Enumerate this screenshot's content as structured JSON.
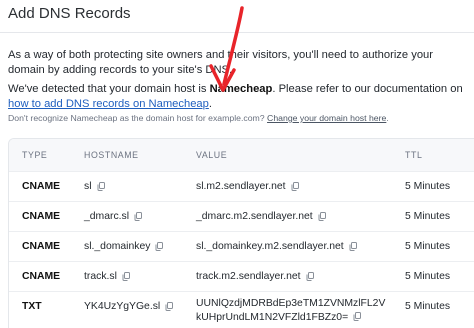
{
  "page": {
    "title": "Add DNS Records",
    "intro": "As a way of both protecting site owners and their visitors, you'll need to authorize your domain by adding records to your site's DNS.",
    "detect_prefix": "We've detected that your domain host is ",
    "detect_host": "Namecheap",
    "detect_middle": ". Please refer to our documentation on ",
    "detect_link": "how to add DNS records on Namecheap",
    "detect_suffix": ".",
    "hint_text": "Don't recognize Namecheap as the domain host for example.com? ",
    "hint_link": "Change your domain host here",
    "hint_suffix": "."
  },
  "table": {
    "headers": {
      "type": "TYPE",
      "hostname": "HOSTNAME",
      "value": "VALUE",
      "ttl": "TTL"
    },
    "rows": [
      {
        "type": "CNAME",
        "hostname": "sl",
        "value": "sl.m2.sendlayer.net",
        "ttl": "5 Minutes"
      },
      {
        "type": "CNAME",
        "hostname": "_dmarc.sl",
        "value": "_dmarc.m2.sendlayer.net",
        "ttl": "5 Minutes"
      },
      {
        "type": "CNAME",
        "hostname": "sl._domainkey",
        "value": "sl._domainkey.m2.sendlayer.net",
        "ttl": "5 Minutes"
      },
      {
        "type": "CNAME",
        "hostname": "track.sl",
        "value": "track.m2.sendlayer.net",
        "ttl": "5 Minutes"
      },
      {
        "type": "TXT",
        "hostname": "YK4UzYgYGe.sl",
        "value_line1": "UUNlQzdjMDRBdEp3eTM1ZVNMzlFL2V",
        "value_line2": "kUHprUndLM1N2VFZld1FBZz0=",
        "ttl": "5 Minutes"
      }
    ]
  },
  "icons": {
    "copy": "copy-icon",
    "annotation": "red-arrow-annotation"
  },
  "colors": {
    "link": "#1f5fbf",
    "arrow": "#e8242a",
    "header_bg": "#f7f8fa"
  }
}
